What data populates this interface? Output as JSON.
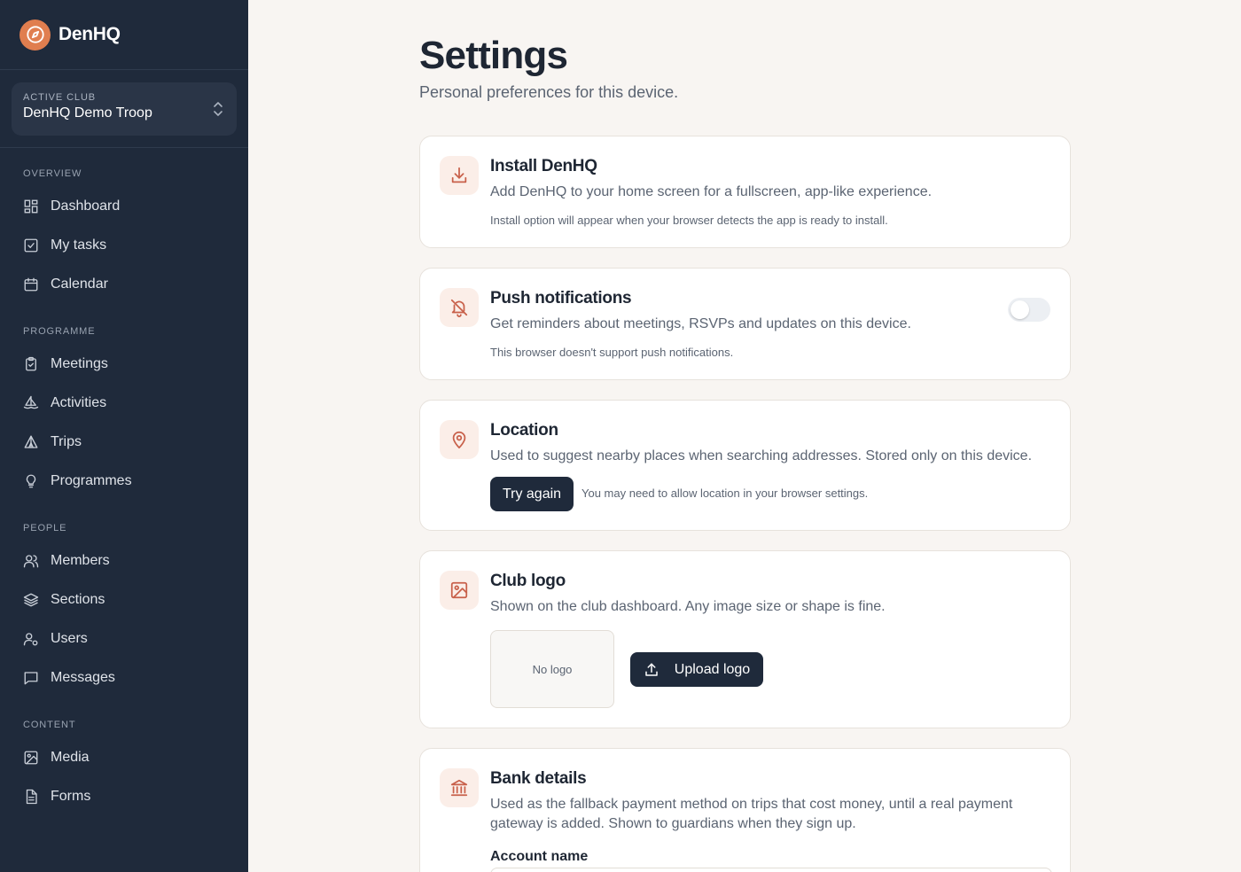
{
  "brand": {
    "name": "DenHQ",
    "icon": "compass-icon",
    "accent": "#e07e4f"
  },
  "club": {
    "kicker": "ACTIVE CLUB",
    "name": "DenHQ Demo Troop"
  },
  "nav": {
    "overview": {
      "heading": "OVERVIEW",
      "items": [
        {
          "label": "Dashboard",
          "icon": "dashboard-icon"
        },
        {
          "label": "My tasks",
          "icon": "checkbox-icon"
        },
        {
          "label": "Calendar",
          "icon": "calendar-icon"
        }
      ]
    },
    "programme": {
      "heading": "PROGRAMME",
      "items": [
        {
          "label": "Meetings",
          "icon": "clipboard-check-icon"
        },
        {
          "label": "Activities",
          "icon": "sailboat-icon"
        },
        {
          "label": "Trips",
          "icon": "tent-icon"
        },
        {
          "label": "Programmes",
          "icon": "lightbulb-icon"
        }
      ]
    },
    "people": {
      "heading": "PEOPLE",
      "items": [
        {
          "label": "Members",
          "icon": "users-icon"
        },
        {
          "label": "Sections",
          "icon": "layers-icon"
        },
        {
          "label": "Users",
          "icon": "user-cog-icon"
        },
        {
          "label": "Messages",
          "icon": "message-icon"
        }
      ]
    },
    "content": {
      "heading": "CONTENT",
      "items": [
        {
          "label": "Media",
          "icon": "image-icon"
        },
        {
          "label": "Forms",
          "icon": "file-text-icon"
        }
      ]
    }
  },
  "page": {
    "title": "Settings",
    "subtitle": "Personal preferences for this device."
  },
  "cards": {
    "install": {
      "title": "Install DenHQ",
      "description": "Add DenHQ to your home screen for a fullscreen, app-like experience.",
      "note": "Install option will appear when your browser detects the app is ready to install.",
      "icon": "download-icon"
    },
    "push": {
      "title": "Push notifications",
      "description": "Get reminders about meetings, RSVPs and updates on this device.",
      "note": "This browser doesn't support push notifications.",
      "icon": "bell-off-icon",
      "enabled": false
    },
    "location": {
      "title": "Location",
      "description": "Used to suggest nearby places when searching addresses. Stored only on this device.",
      "button": "Try again",
      "note": "You may need to allow location in your browser settings.",
      "icon": "map-pin-icon"
    },
    "logo": {
      "title": "Club logo",
      "description": "Shown on the club dashboard. Any image size or shape is fine.",
      "placeholder": "No logo",
      "button": "Upload logo",
      "icon": "image-icon"
    },
    "bank": {
      "title": "Bank details",
      "description_line1": "Used as the fallback payment method on trips that cost money, until a real payment",
      "description_line2": "gateway is added. Shown to guardians when they sign up.",
      "account_label": "Account name",
      "account_value": "",
      "icon": "bank-icon"
    }
  },
  "colors": {
    "sidebar": "#1f2a3b",
    "accent": "#e07e4f",
    "icon_accent": "#c8604a",
    "background": "#f8f5f2"
  }
}
